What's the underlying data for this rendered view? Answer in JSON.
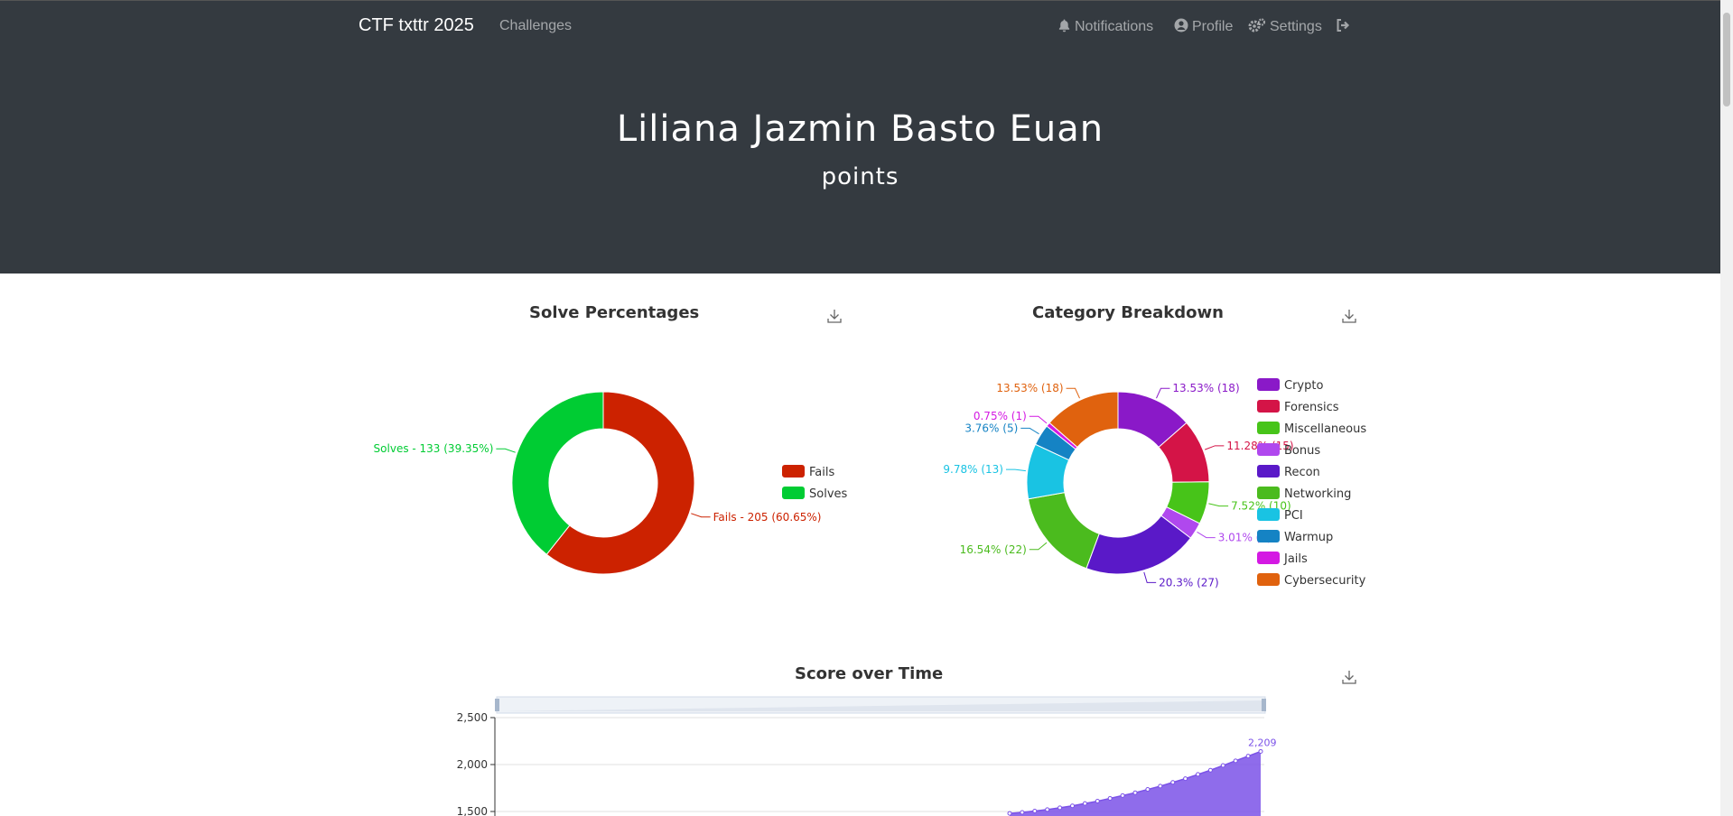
{
  "nav": {
    "brand": "CTF txttr 2025",
    "challenges": "Challenges",
    "notifications": "Notifications",
    "profile": "Profile",
    "settings": "Settings"
  },
  "header": {
    "name": "Liliana Jazmin Basto Euan",
    "subtitle": "points"
  },
  "charts": {
    "solve_title": "Solve Percentages",
    "category_title": "Category Breakdown",
    "score_title": "Score over Time"
  },
  "chart_data": [
    {
      "type": "pie",
      "title": "Solve Percentages",
      "legend_position": "right",
      "slices": [
        {
          "name": "Fails",
          "value": 205,
          "label": "Fails - 205 (60.65%)",
          "color": "#cc2200"
        },
        {
          "name": "Solves",
          "value": 133,
          "label": "Solves - 133 (39.35%)",
          "color": "#00cc33"
        }
      ]
    },
    {
      "type": "pie",
      "title": "Category Breakdown",
      "legend_position": "right",
      "slices": [
        {
          "name": "Crypto",
          "value": 18,
          "label": "13.53% (18)",
          "color": "#8a19c8"
        },
        {
          "name": "Forensics",
          "value": 15,
          "label": "11.28% (15)",
          "color": "#d41447"
        },
        {
          "name": "Miscellaneous",
          "value": 10,
          "label": "7.52% (10)",
          "color": "#47c419"
        },
        {
          "name": "Bonus",
          "value": 4,
          "label": "3.01% (4)",
          "color": "#b048ee"
        },
        {
          "name": "Recon",
          "value": 27,
          "label": "20.3% (27)",
          "color": "#5a19c8"
        },
        {
          "name": "Networking",
          "value": 22,
          "label": "16.54% (22)",
          "color": "#4bbb1e"
        },
        {
          "name": "PCI",
          "value": 13,
          "label": "9.78% (13)",
          "color": "#19c3e3"
        },
        {
          "name": "Warmup",
          "value": 5,
          "label": "3.76% (5)",
          "color": "#1583c4"
        },
        {
          "name": "Jails",
          "value": 1,
          "label": "0.75% (1)",
          "color": "#d419e3"
        },
        {
          "name": "Cybersecurity",
          "value": 18,
          "label": "13.53% (18)",
          "color": "#e0620e"
        }
      ]
    },
    {
      "type": "area",
      "title": "Score over Time",
      "color": "#7b52e8",
      "ylim": [
        1500,
        2500
      ],
      "y_ticks": [
        "2,500",
        "2,000",
        "1,500"
      ],
      "visible_series_points": [
        1480,
        1490,
        1505,
        1520,
        1540,
        1560,
        1585,
        1610,
        1640,
        1670,
        1700,
        1735,
        1770,
        1810,
        1850,
        1895,
        1940,
        1990,
        2040,
        2090,
        2140
      ],
      "last_label": "2,209"
    }
  ]
}
